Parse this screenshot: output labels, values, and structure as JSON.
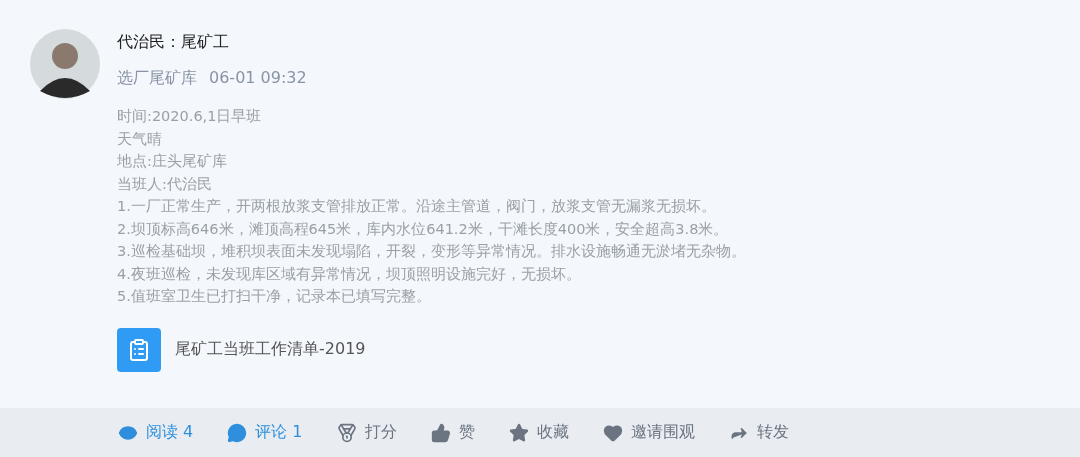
{
  "post": {
    "author": "代治民：尾矿工",
    "source": "选厂尾矿库",
    "time": "06-01 09:32",
    "lines": [
      "时间:2020.6,1日早班",
      "天气晴",
      "地点:庄头尾矿库",
      "当班人:代治民",
      "1.一厂正常生产，开两根放浆支管排放正常。沿途主管道，阀门，放浆支管无漏浆无损坏。",
      "2.坝顶标高646米，滩顶高程645米，库内水位641.2米，干滩长度400米，安全超高3.8米。",
      "3.巡检基础坝，堆积坝表面未发现塌陷，开裂，变形等异常情况。排水设施畅通无淤堵无杂物。",
      "4.夜班巡检，未发现库区域有异常情况，坝顶照明设施完好，无损坏。",
      "5.值班室卫生已打扫干净，记录本已填写完整。"
    ],
    "attachment": "尾矿工当班工作清单-2019"
  },
  "actions": [
    {
      "kind": "read",
      "label": "阅读 4",
      "active": true
    },
    {
      "kind": "comment",
      "label": "评论 1",
      "active": true
    },
    {
      "kind": "rate",
      "label": "打分",
      "active": false
    },
    {
      "kind": "like",
      "label": "赞",
      "active": false
    },
    {
      "kind": "favorite",
      "label": "收藏",
      "active": false
    },
    {
      "kind": "invite",
      "label": "邀请围观",
      "active": false
    },
    {
      "kind": "share",
      "label": "转发",
      "active": false
    }
  ]
}
